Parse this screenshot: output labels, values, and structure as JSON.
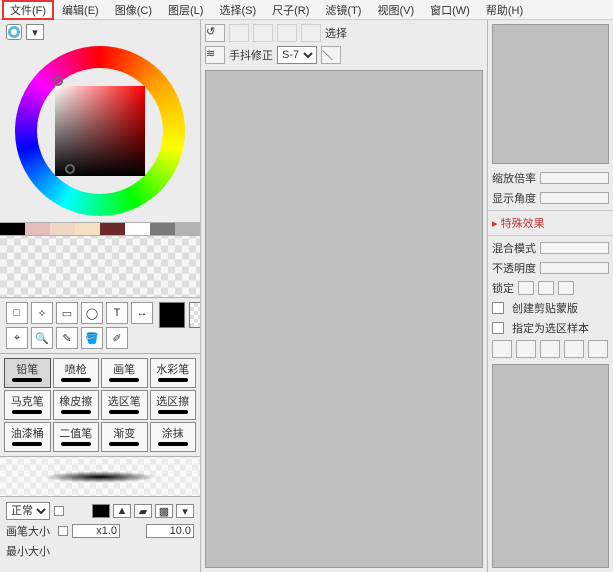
{
  "menu": {
    "file": "文件(F)",
    "edit": "编辑(E)",
    "image": "图像(C)",
    "layer": "图层(L)",
    "select": "选择(S)",
    "ruler": "尺子(R)",
    "filter": "滤镜(T)",
    "view": "视图(V)",
    "window": "窗口(W)",
    "help": "帮助(H)"
  },
  "swatches": [
    "#000000",
    "#e6bdbd",
    "#f0d6c4",
    "#f5e0c4",
    "#6a2a2a",
    "#ffffff",
    "#7a7a7a",
    "#b3b3b3"
  ],
  "tool_tips": [
    "□",
    "✧",
    "▭",
    "◯",
    "T",
    "↔",
    "⌖",
    "🔍",
    "✎",
    "🪣",
    "✐"
  ],
  "brushes": [
    "铅笔",
    "喷枪",
    "画笔",
    "水彩笔",
    "马克笔",
    "橡皮擦",
    "选区笔",
    "选区擦",
    "油漆桶",
    "二值笔",
    "渐变",
    "涂抹"
  ],
  "params": {
    "mode_label": "正常",
    "brush_size_label": "画笔大小",
    "brush_size_mult": "x1.0",
    "brush_size_val": "10.0",
    "min_size_label": "最小大小"
  },
  "mid": {
    "select_label": "选择",
    "stab_label": "手抖修正",
    "stab_value": "S-7"
  },
  "right": {
    "zoom_label": "缩放倍率",
    "angle_label": "显示角度",
    "fx_label": "特殊效果",
    "blend_label": "混合模式",
    "opacity_label": "不透明度",
    "lock_label": "锁定",
    "clip_label": "创建剪贴蒙版",
    "as_sel_label": "指定为选区样本"
  }
}
